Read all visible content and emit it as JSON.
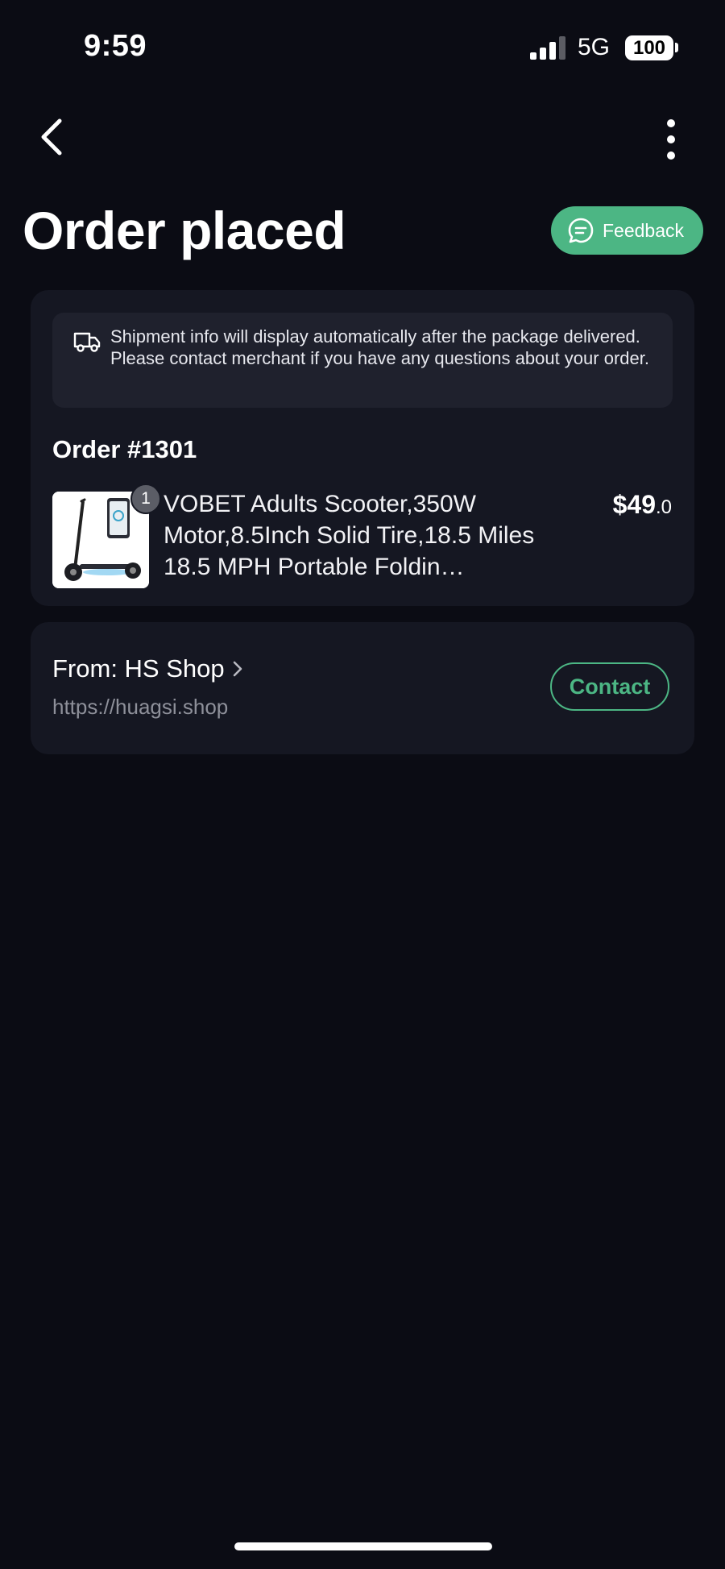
{
  "status_bar": {
    "time": "9:59",
    "network": "5G",
    "battery": "100"
  },
  "header": {
    "title": "Order placed",
    "back_icon": "chevron-left-icon",
    "more_icon": "more-vertical-icon",
    "feedback": {
      "label": "Feedback",
      "icon": "chat-bubble-icon"
    }
  },
  "notice": {
    "icon": "truck-icon",
    "text": "Shipment info will display automatically after the package delivered. Please contact merchant if you have any questions about your order."
  },
  "order": {
    "number": "Order #1301",
    "items": [
      {
        "quantity": "1",
        "title": "VOBET Adults  Scooter,350W Motor,8.5Inch Solid Tire,18.5 Miles 18.5 MPH Portable Foldin…",
        "price_main": "$49",
        "price_cents": ".0",
        "image": "electric-scooter-product-image"
      }
    ]
  },
  "shop": {
    "name": "From: HS Shop",
    "url": "https://huagsi.shop",
    "contact_label": "Contact"
  },
  "colors": {
    "background": "#0b0c14",
    "card": "#151722",
    "accent": "#4cb684"
  }
}
